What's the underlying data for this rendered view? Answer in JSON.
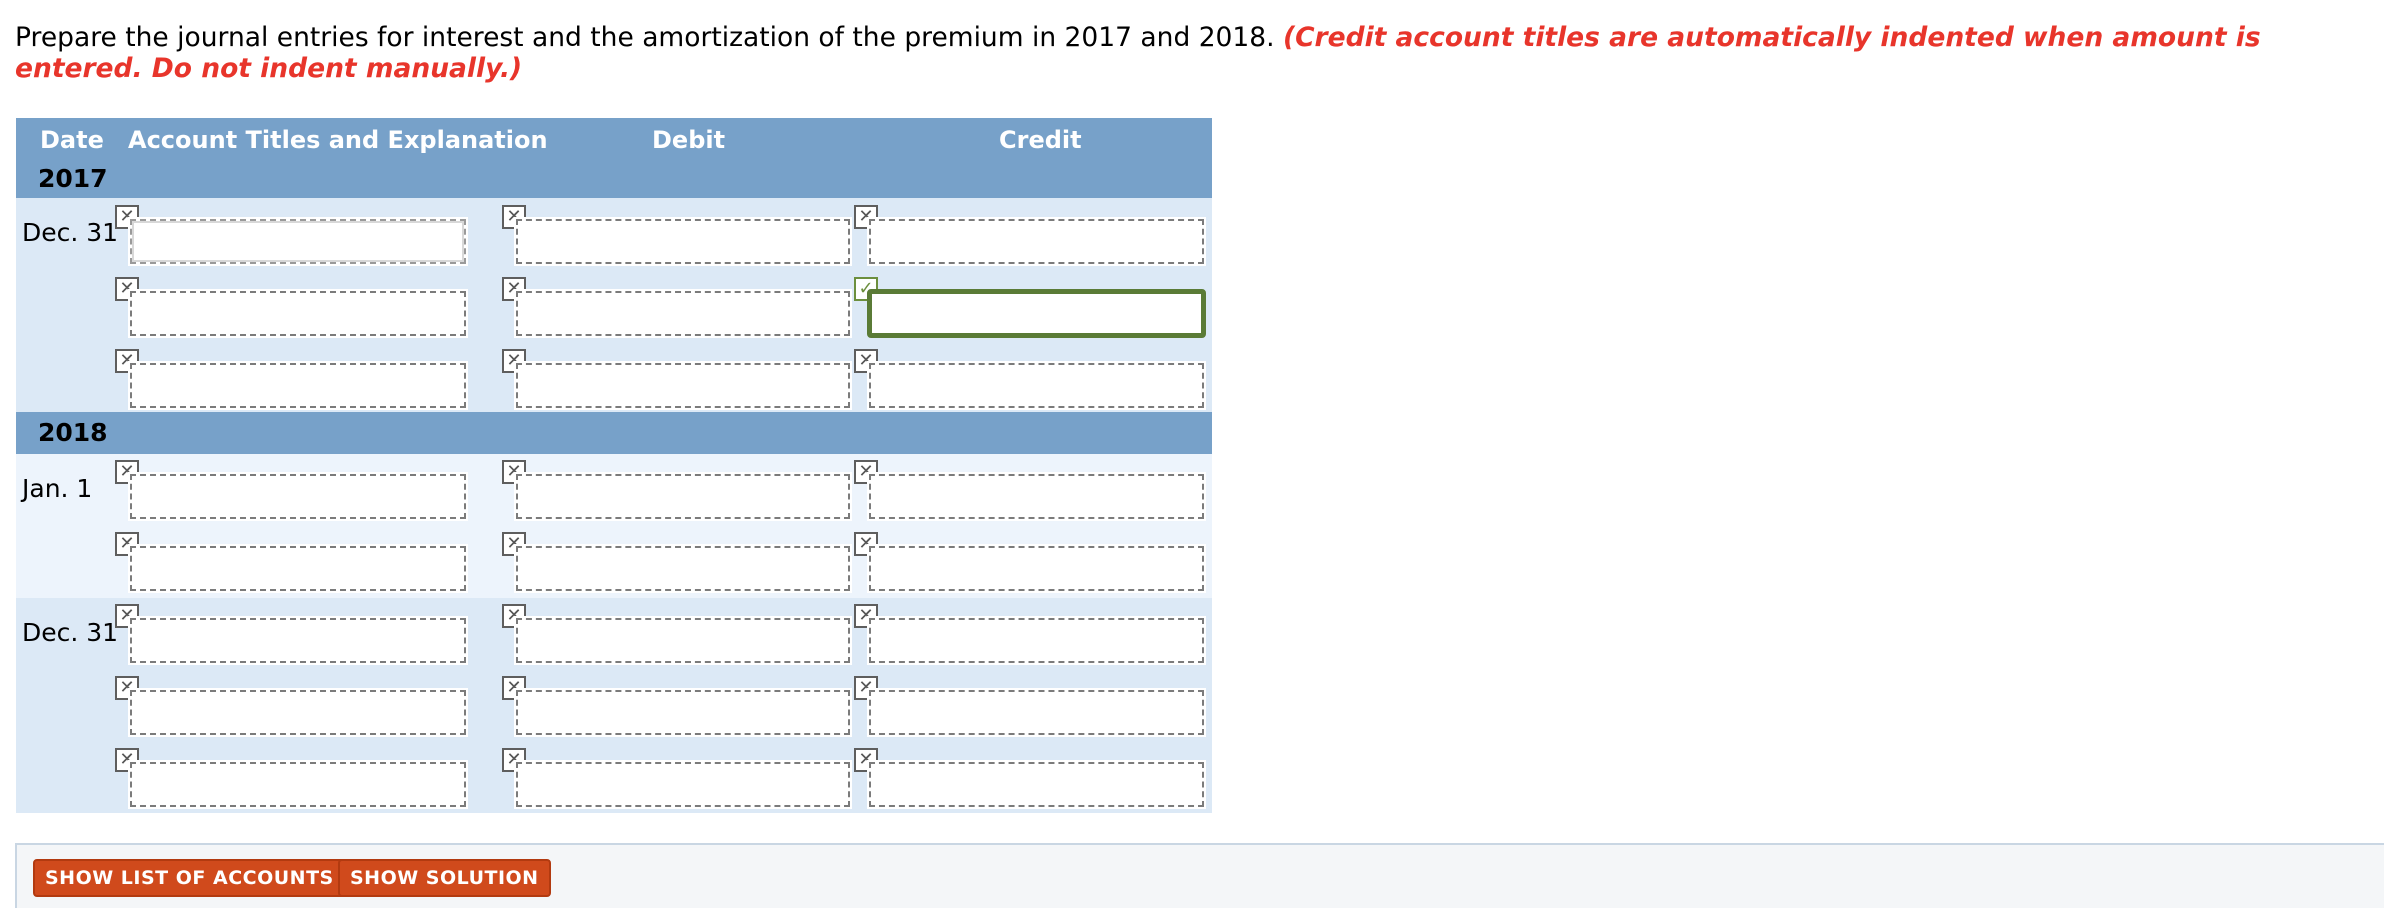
{
  "instructions": {
    "text": "Prepare the journal entries for interest and the amortization of the premium in 2017 and 2018.",
    "note": "(Credit account titles are automatically indented when amount is entered. Do not indent manually.)"
  },
  "table": {
    "headers": {
      "date": "Date",
      "account": "Account Titles and Explanation",
      "debit": "Debit",
      "credit": "Credit"
    },
    "years": [
      "2017",
      "2018"
    ],
    "dates": [
      "Dec. 31",
      "Jan. 1",
      "Dec. 31"
    ]
  },
  "icons": {
    "cleared_mark": "x-mark-icon",
    "checked_mark": "check-mark-icon"
  },
  "colors": {
    "header_bg": "#77a1c9",
    "row_dark": "#dce9f6",
    "row_light": "#edf4fc",
    "note_red": "#e8352b",
    "button_bg": "#d04a1c",
    "focus_green": "#5a7b36"
  },
  "buttons": {
    "show_accounts": "SHOW LIST OF ACCOUNTS",
    "show_solution": "SHOW SOLUTION"
  }
}
